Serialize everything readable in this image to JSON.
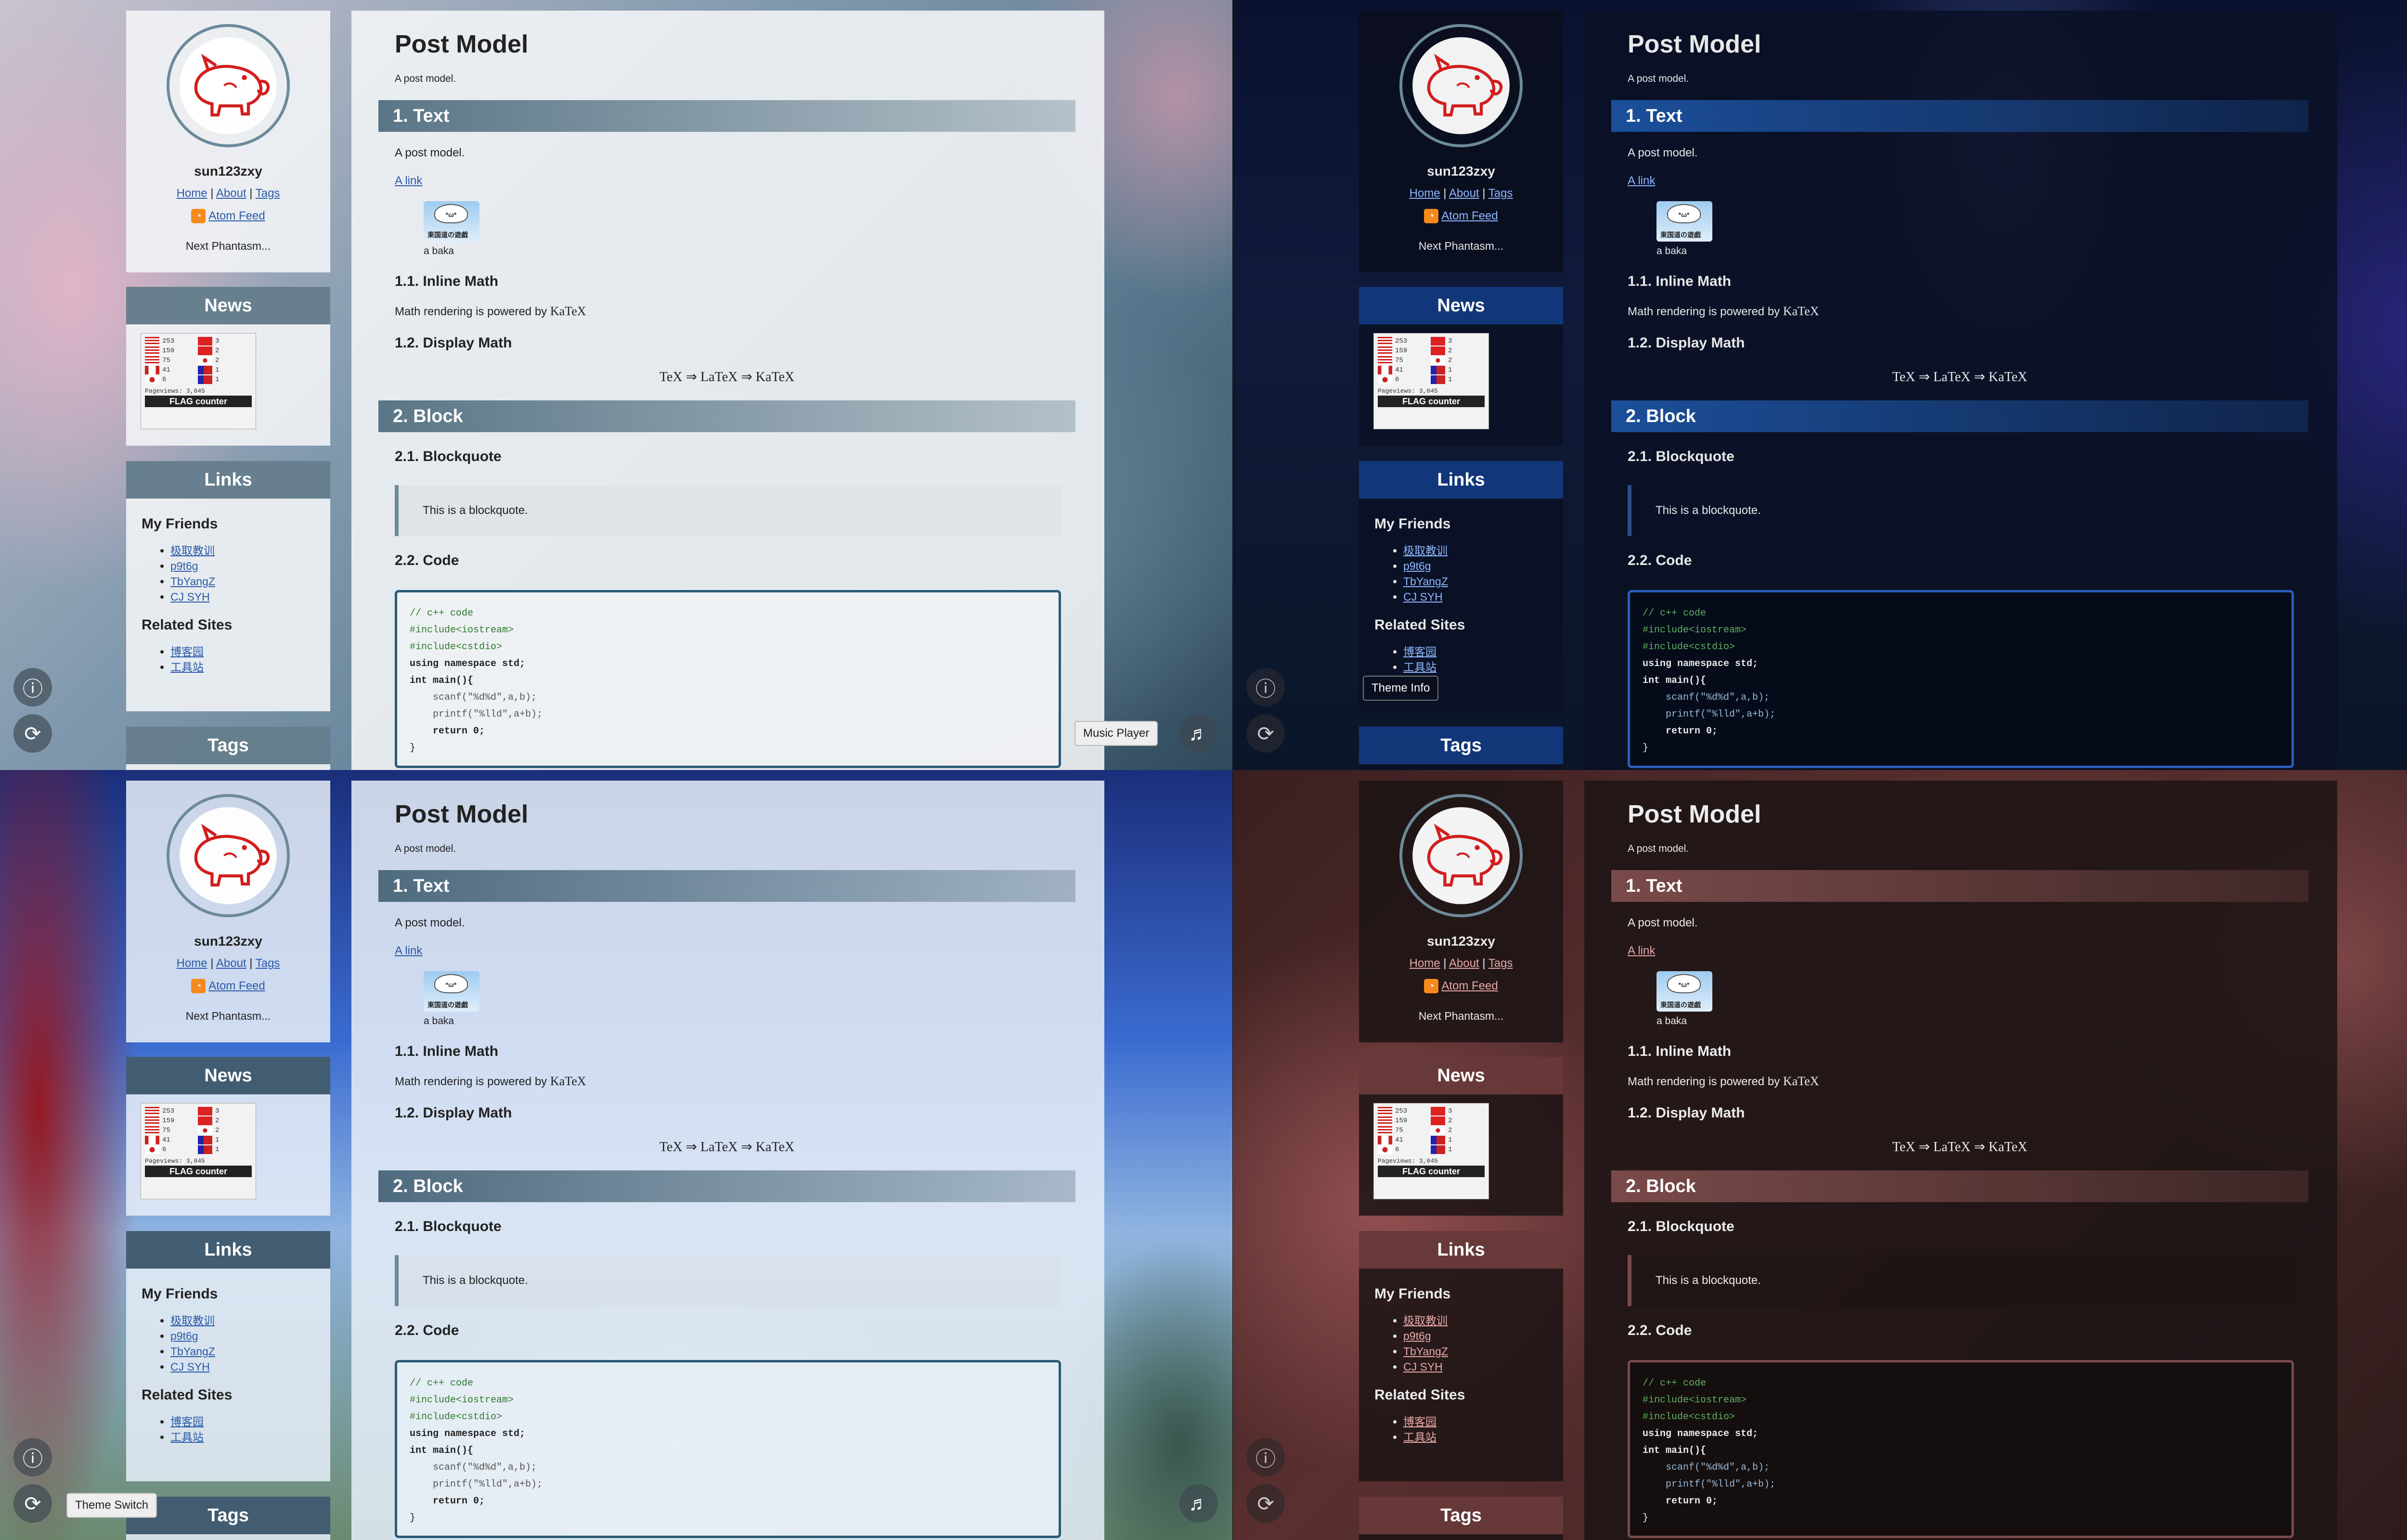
{
  "profile": {
    "username": "sun123zxy",
    "nav": [
      "Home",
      "About",
      "Tags"
    ],
    "nav_sep": "|",
    "atom": "Atom Feed",
    "next": "Next Phantasm..."
  },
  "news": {
    "title": "News",
    "flag_counter": {
      "rows": [
        {
          "left": "253",
          "right": "3"
        },
        {
          "left": "159",
          "right": "2"
        },
        {
          "left": "75",
          "right": "2"
        },
        {
          "left": "41",
          "right": "1"
        },
        {
          "left": "6",
          "right": "1"
        }
      ],
      "pageviews": "Pageviews: 3,045",
      "brand": "FLAG counter"
    }
  },
  "links": {
    "title": "Links",
    "friends_title": "My Friends",
    "friends": [
      "极取教训",
      "p9t6g",
      "TbYangZ",
      "CJ SYH"
    ],
    "related_title": "Related Sites",
    "related": [
      "博客园",
      "工具站"
    ]
  },
  "tags": {
    "title": "Tags"
  },
  "post": {
    "title": "Post Model",
    "subtitle": "A post model.",
    "h_text": "1. Text",
    "text": "A post model.",
    "link": "A link",
    "img_face": "*ω*",
    "img_caption": "東国道の遊戯",
    "img_alt": "a baka",
    "h_inline": "1.1. Inline Math",
    "inline_text": "Math rendering is powered by",
    "katex": "KaTeX",
    "h_display": "1.2. Display Math",
    "display_math": "TeX ⇒ LaTeX ⇒ KaTeX",
    "h_block": "2. Block",
    "h_quote": "2.1. Blockquote",
    "quote": "This is a blockquote.",
    "h_code": "2.2. Code",
    "code": [
      {
        "type": "cm",
        "text": "// c++ code"
      },
      {
        "type": "pp",
        "text": "#include<iostream>"
      },
      {
        "type": "pp",
        "text": "#include<cstdio>"
      },
      {
        "type": "kw",
        "text": "using namespace std;"
      },
      {
        "type": "kw",
        "text": "int main(){"
      },
      {
        "type": "str",
        "text": "    scanf(\"%d%d\",a,b);"
      },
      {
        "type": "str",
        "text": "    printf(\"%lld\",a+b);"
      },
      {
        "type": "kw",
        "text": "    return 0;"
      },
      {
        "type": "plain",
        "text": "}"
      }
    ]
  },
  "panels": [
    {
      "theme": "light",
      "tooltip": "Music Player"
    },
    {
      "theme": "dark",
      "tooltip": "Theme Info"
    },
    {
      "theme": "blue",
      "tooltip": "Theme Switch"
    },
    {
      "theme": "red",
      "tooltip": ""
    }
  ],
  "icons": {
    "info": "info-icon",
    "switch": "refresh-icon",
    "music": "music-note-icon"
  },
  "colors": {
    "light_accent": "#5a7686",
    "dark_accent": "#1b4f9a",
    "red_accent": "#7a4a4a",
    "rss": "#f58a1c"
  }
}
